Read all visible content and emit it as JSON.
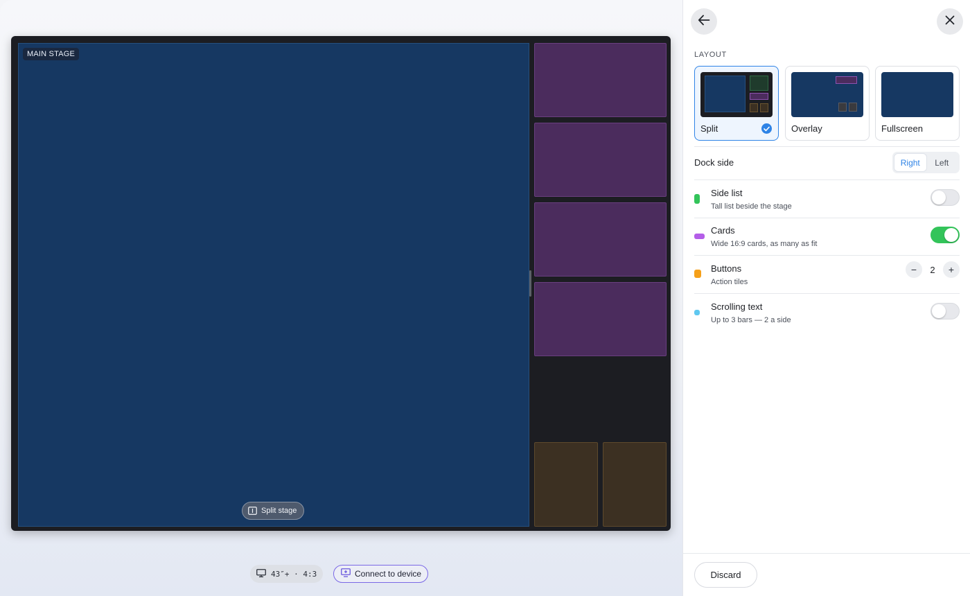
{
  "preview": {
    "stage_label": "MAIN STAGE",
    "split_chip_label": "Split stage",
    "display_info": "43″+ · 4:3",
    "connect_label": "Connect to device"
  },
  "panel": {
    "section_label": "LAYOUT",
    "layouts": [
      {
        "label": "Split",
        "selected": true
      },
      {
        "label": "Overlay",
        "selected": false
      },
      {
        "label": "Fullscreen",
        "selected": false
      }
    ],
    "dock": {
      "label": "Dock side",
      "options": [
        "Right",
        "Left"
      ],
      "selected": "Right"
    },
    "features": [
      {
        "title": "Side list",
        "subtitle": "Tall list beside the stage",
        "color": "#33c45a",
        "control": "toggle",
        "on": false
      },
      {
        "title": "Cards",
        "subtitle": "Wide 16:9 cards, as many as fit",
        "color": "#b45ee8",
        "control": "toggle",
        "on": true
      },
      {
        "title": "Buttons",
        "subtitle": "Action tiles",
        "color": "#f5a01a",
        "control": "stepper",
        "value": "2"
      },
      {
        "title": "Scrolling text",
        "subtitle": "Up to 3 bars — 2 a side",
        "color": "#5fc8f0",
        "control": "toggle",
        "on": false
      }
    ],
    "discard_label": "Discard"
  },
  "icons": {
    "back": "arrow-left-icon",
    "close": "close-icon",
    "split": "split-stage-icon",
    "monitor": "monitor-icon",
    "cast": "cast-icon",
    "check": "check-icon"
  }
}
